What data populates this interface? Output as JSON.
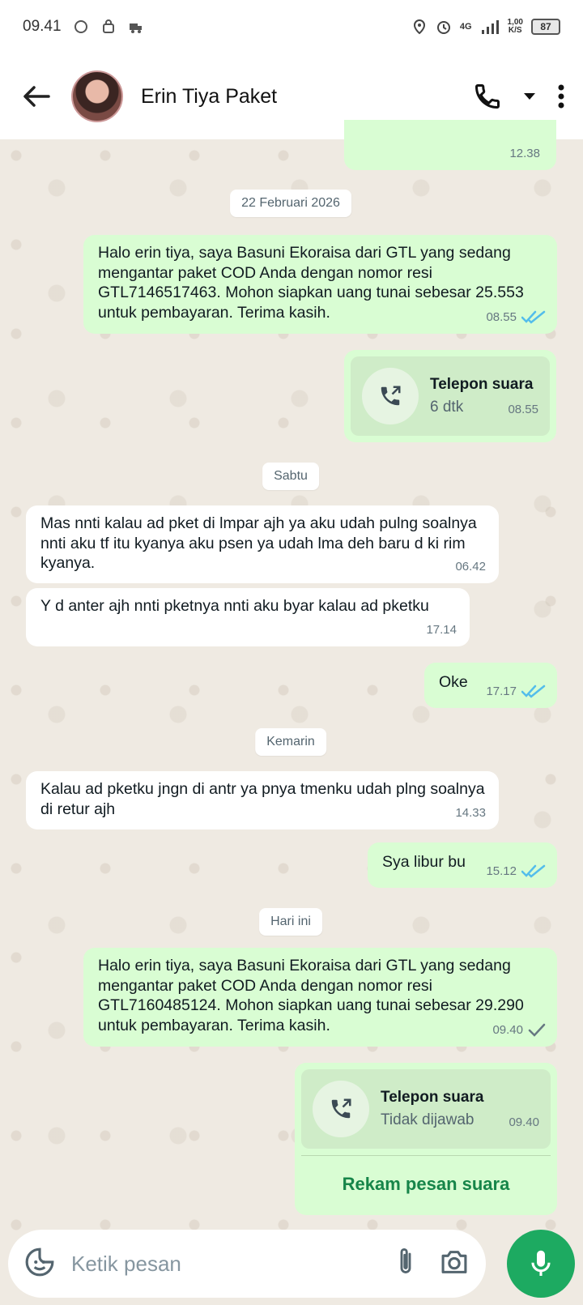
{
  "status_bar": {
    "time": "09.41",
    "net_speed_top": "1,00",
    "net_speed_bottom": "K/S",
    "signal_label": "4G",
    "battery": "87"
  },
  "header": {
    "contact_name": "Erin Tiya Paket"
  },
  "messages": [
    {
      "type": "date",
      "text": "22 Februari 2026"
    },
    {
      "type": "out",
      "text": "Halo erin tiya, saya Basuni Ekoraisa dari GTL yang sedang mengantar paket COD Anda dengan nomor resi GTL7146517463. Mohon siapkan uang tunai sebesar 25.553 untuk pembayaran. Terima kasih.",
      "time": "08.55",
      "status": "read"
    },
    {
      "type": "call",
      "title": "Telepon suara",
      "sub": "6 dtk",
      "time": "08.55"
    },
    {
      "type": "date",
      "text": "Sabtu"
    },
    {
      "type": "in",
      "text": "Mas nnti kalau ad pket di lmpar ajh ya aku udah pulng soalnya nnti aku tf itu kyanya aku psen ya udah lma deh baru d ki rim kyanya.",
      "time": "06.42"
    },
    {
      "type": "in",
      "text": "Y d anter ajh nnti pketnya nnti aku byar kalau ad pketku",
      "time": "17.14"
    },
    {
      "type": "out",
      "text": "Oke",
      "time": "17.17",
      "status": "read"
    },
    {
      "type": "date",
      "text": "Kemarin"
    },
    {
      "type": "in",
      "text": "Kalau ad pketku jngn di antr ya pnya tmenku udah plng soalnya di retur ajh",
      "time": "14.33"
    },
    {
      "type": "out",
      "text": "Sya libur bu",
      "time": "15.12",
      "status": "read"
    },
    {
      "type": "date",
      "text": "Hari ini"
    },
    {
      "type": "out",
      "text": "Halo erin tiya, saya Basuni Ekoraisa dari GTL yang sedang mengantar paket COD Anda dengan nomor resi GTL7160485124. Mohon siapkan uang tunai sebesar 29.290 untuk pembayaran. Terima kasih.",
      "time": "09.40",
      "status": "sent"
    },
    {
      "type": "call",
      "title": "Telepon suara",
      "sub": "Tidak dijawab",
      "time": "09.40",
      "action": "Rekam pesan suara"
    }
  ],
  "top_partial_time": "12.38",
  "composer": {
    "placeholder": "Ketik pesan"
  },
  "colors": {
    "outgoing_bubble": "#d9fdd3",
    "incoming_bubble": "#ffffff",
    "read_tick": "#53bdeb",
    "accent_green": "#1daa61",
    "chat_bg": "#efeae2"
  }
}
